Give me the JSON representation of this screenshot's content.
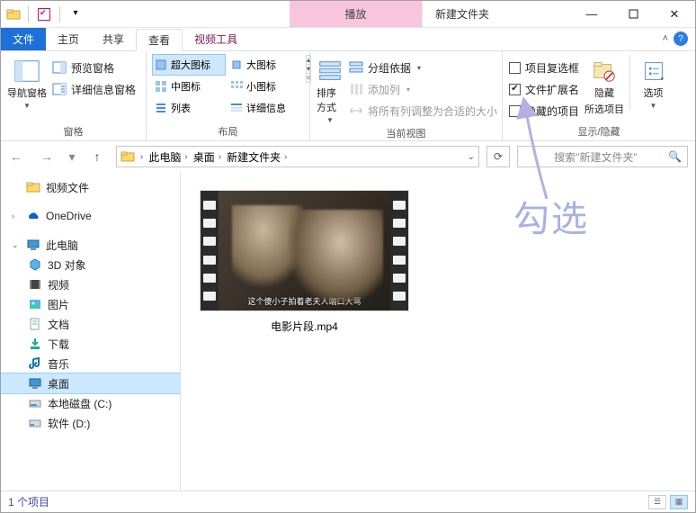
{
  "window": {
    "play_tab": "播放",
    "folder_title": "新建文件夹"
  },
  "tabs": {
    "file": "文件",
    "home": "主页",
    "share": "共享",
    "view": "查看",
    "video_tools": "视频工具"
  },
  "ribbon": {
    "panes_group": "窗格",
    "layout_group": "布局",
    "current_view_group": "当前视图",
    "show_hide_group": "显示/隐藏",
    "nav_pane": "导航窗格",
    "preview_pane": "预览窗格",
    "details_pane": "详细信息窗格",
    "layout_items": {
      "extra_large": "超大图标",
      "large": "大图标",
      "medium": "中图标",
      "small": "小图标",
      "list": "列表",
      "details": "详细信息"
    },
    "sort_by": "排序方式",
    "group_by": "分组依据",
    "add_columns": "添加列",
    "fit_columns": "将所有列调整为合适的大小",
    "item_checkboxes": "项目复选框",
    "file_ext": "文件扩展名",
    "hidden_items": "隐藏的项目",
    "hide_selected": "隐藏\n所选项目",
    "hide_selected_l1": "隐藏",
    "hide_selected_l2": "所选项目",
    "options": "选项"
  },
  "address": {
    "this_pc": "此电脑",
    "desktop": "桌面",
    "folder": "新建文件夹"
  },
  "search_placeholder": "搜索\"新建文件夹\"",
  "sidebar": {
    "video_files": "视频文件",
    "onedrive": "OneDrive",
    "this_pc": "此电脑",
    "objects3d": "3D 对象",
    "videos": "视频",
    "pictures": "图片",
    "documents": "文档",
    "downloads": "下载",
    "music": "音乐",
    "desktop": "桌面",
    "local_c": "本地磁盘 (C:)",
    "soft_d": "软件 (D:)"
  },
  "file": {
    "name": "电影片段.mp4",
    "subtitle": "这个傻小子拍着老夫人端口大骂"
  },
  "status": {
    "count": "1 个项目"
  },
  "annotation": {
    "text": "勾选"
  }
}
